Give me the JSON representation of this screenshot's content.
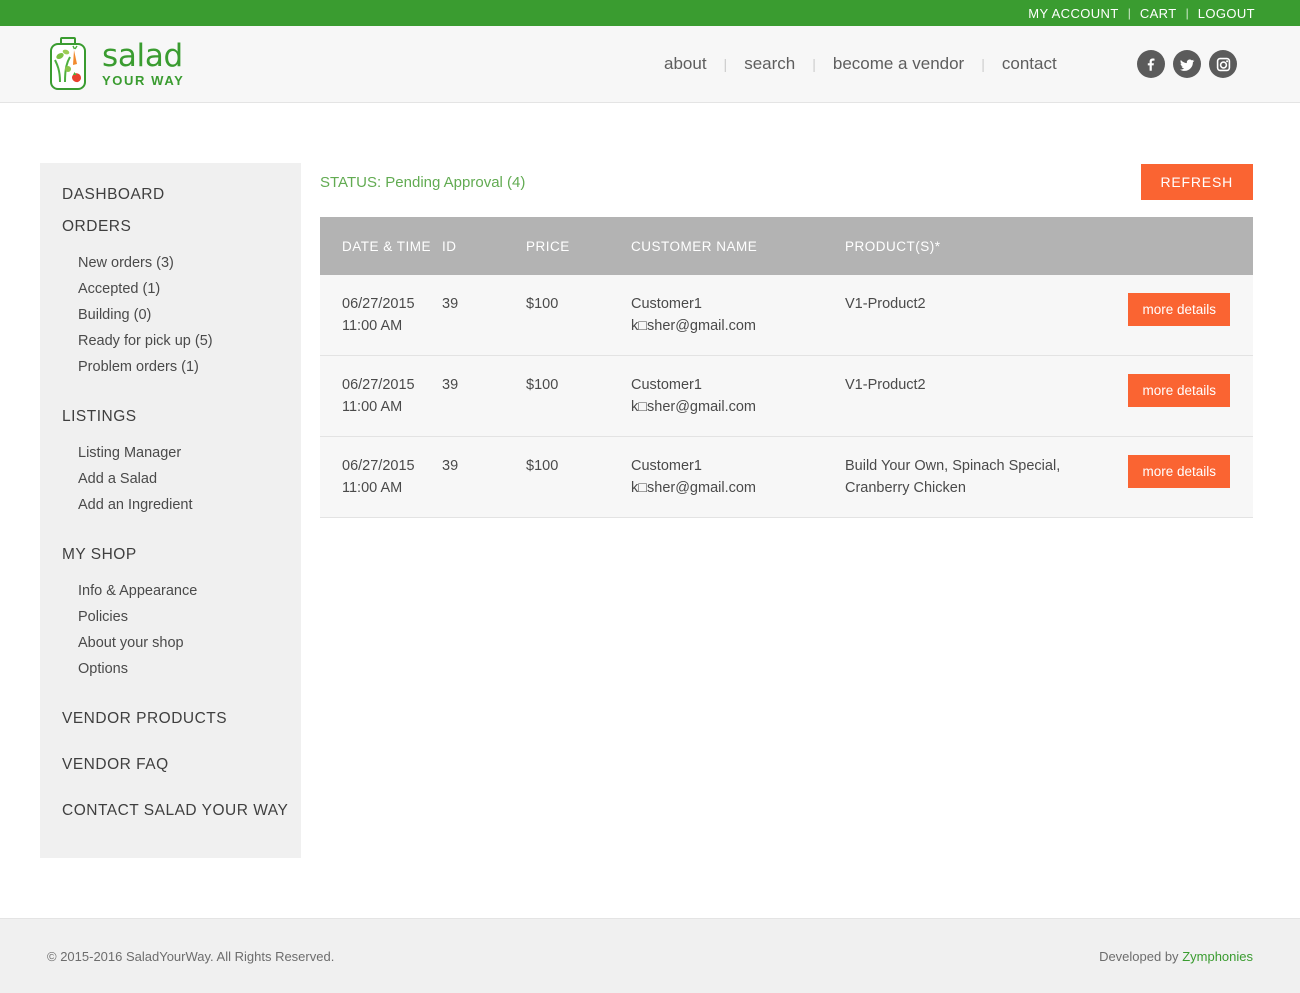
{
  "topbar": {
    "links": [
      {
        "label": "MY ACCOUNT",
        "name": "my-account-link"
      },
      {
        "label": "CART",
        "name": "cart-link"
      },
      {
        "label": "LOGOUT",
        "name": "logout-link"
      }
    ],
    "separator": "|",
    "bg_color": "#3a9c30"
  },
  "header": {
    "logo": {
      "main": "salad",
      "sub": "YOUR WAY",
      "color": "#3a9c30"
    },
    "nav": [
      {
        "label": "about",
        "name": "nav-about"
      },
      {
        "label": "search",
        "name": "nav-search"
      },
      {
        "label": "become a vendor",
        "name": "nav-become-a-vendor"
      },
      {
        "label": "contact",
        "name": "nav-contact"
      }
    ],
    "nav_separator": "|",
    "social": [
      {
        "label": "facebook-icon"
      },
      {
        "label": "twitter-icon"
      },
      {
        "label": "instagram-icon"
      }
    ]
  },
  "sidebar": {
    "sections": [
      {
        "title": "DASHBOARD",
        "items": []
      },
      {
        "title": "ORDERS",
        "items": [
          {
            "label": "New orders (3)"
          },
          {
            "label": "Accepted (1)"
          },
          {
            "label": "Building (0)"
          },
          {
            "label": "Ready for pick up (5)"
          },
          {
            "label": "Problem orders (1)"
          }
        ]
      },
      {
        "title": "LISTINGS",
        "items": [
          {
            "label": "Listing Manager"
          },
          {
            "label": "Add a Salad"
          },
          {
            "label": "Add an Ingredient"
          }
        ]
      },
      {
        "title": "MY SHOP",
        "items": [
          {
            "label": "Info & Appearance"
          },
          {
            "label": "Policies"
          },
          {
            "label": "About your shop"
          },
          {
            "label": "Options"
          }
        ]
      },
      {
        "title": "VENDOR PRODUCTS",
        "items": []
      },
      {
        "title": "VENDOR FAQ",
        "items": []
      },
      {
        "title": "CONTACT SALAD YOUR WAY",
        "items": []
      }
    ]
  },
  "content": {
    "status": "STATUS: Pending Approval (4)",
    "status_color": "#62ab52",
    "refresh_label": "REFRESH",
    "accent_color": "#fa6432",
    "table": {
      "columns": [
        {
          "label": "DATE & TIME"
        },
        {
          "label": "ID"
        },
        {
          "label": "PRICE"
        },
        {
          "label": "CUSTOMER NAME"
        },
        {
          "label": "PRODUCT(S)*"
        },
        {
          "label": ""
        }
      ],
      "rows": [
        {
          "date": "06/27/2015",
          "time": "11:00 AM",
          "id": "39",
          "price": "$100",
          "customer_name": "Customer1",
          "customer_email": "k□sher@gmail.com",
          "products": "V1-Product2",
          "action_label": "more details"
        },
        {
          "date": "06/27/2015",
          "time": "11:00 AM",
          "id": "39",
          "price": "$100",
          "customer_name": "Customer1",
          "customer_email": "k□sher@gmail.com",
          "products": "V1-Product2",
          "action_label": "more details"
        },
        {
          "date": "06/27/2015",
          "time": "11:00 AM",
          "id": "39",
          "price": "$100",
          "customer_name": "Customer1",
          "customer_email": "k□sher@gmail.com",
          "products": "Build Your Own, Spinach Special, Cranberry Chicken",
          "action_label": "more details"
        }
      ]
    }
  },
  "footer": {
    "copyright": "© 2015-2016 SaladYourWay. All Rights Reserved.",
    "developed_prefix": "Developed by ",
    "developer": "Zymphonies"
  }
}
